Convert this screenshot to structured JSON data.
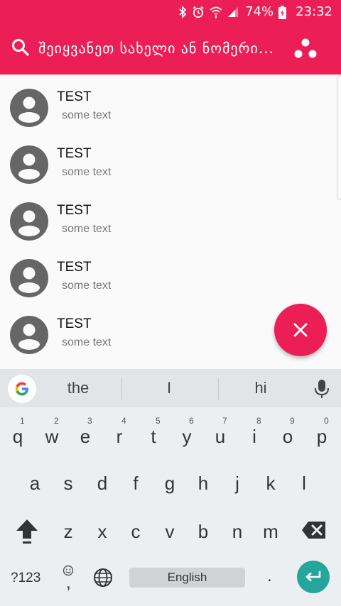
{
  "status_bar": {
    "battery_percent": "74%",
    "time": "23:32",
    "icons": [
      "bluetooth-icon",
      "alarm-icon",
      "wifi-icon",
      "signal-icon",
      "battery-charging-icon"
    ]
  },
  "search": {
    "placeholder": "შეიყვანეთ სახელი ან ნომერი...",
    "icon": "search-icon",
    "menu_icon": "three-dots-icon"
  },
  "contacts": [
    {
      "name": "TEST",
      "subtitle": "some text"
    },
    {
      "name": "TEST",
      "subtitle": "some text"
    },
    {
      "name": "TEST",
      "subtitle": "some text"
    },
    {
      "name": "TEST",
      "subtitle": "some text"
    },
    {
      "name": "TEST",
      "subtitle": "some text"
    }
  ],
  "fab": {
    "icon": "close-icon"
  },
  "keyboard": {
    "suggestions": [
      "the",
      "I",
      "hi"
    ],
    "row1": [
      {
        "ch": "q",
        "num": "1"
      },
      {
        "ch": "w",
        "num": "2"
      },
      {
        "ch": "e",
        "num": "3"
      },
      {
        "ch": "r",
        "num": "4"
      },
      {
        "ch": "t",
        "num": "5"
      },
      {
        "ch": "y",
        "num": "6"
      },
      {
        "ch": "u",
        "num": "7"
      },
      {
        "ch": "i",
        "num": "8"
      },
      {
        "ch": "o",
        "num": "9"
      },
      {
        "ch": "p",
        "num": "0"
      }
    ],
    "row2": [
      "a",
      "s",
      "d",
      "f",
      "g",
      "h",
      "j",
      "k",
      "l"
    ],
    "row3": [
      "z",
      "x",
      "c",
      "v",
      "b",
      "n",
      "m"
    ],
    "symbols_label": "?123",
    "space_label": "English",
    "period_label": ".",
    "emoji_hint": ","
  },
  "colors": {
    "accent": "#ec1e56",
    "enter_key": "#26a69a",
    "avatar": "#666666"
  }
}
